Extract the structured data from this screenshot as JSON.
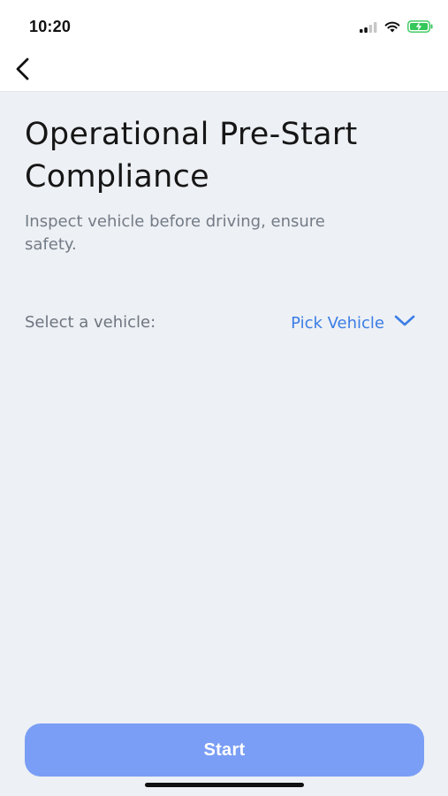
{
  "status_bar": {
    "time": "10:20",
    "icons": [
      "cellular-signal-icon",
      "wifi-icon",
      "battery-charging-icon"
    ]
  },
  "nav": {
    "back_icon": "chevron-left-icon"
  },
  "main": {
    "title": "Operational Pre-Start Compliance",
    "subtitle": "Inspect vehicle before driving, ensure safety.",
    "vehicle_label": "Select a vehicle:",
    "vehicle_picker": {
      "label": "Pick Vehicle",
      "icon": "chevron-down-icon"
    }
  },
  "footer": {
    "start_label": "Start"
  },
  "colors": {
    "background": "#edf0f4",
    "accent": "#3b7de6",
    "button": "#7a9ef5",
    "battery_green": "#34c759"
  }
}
